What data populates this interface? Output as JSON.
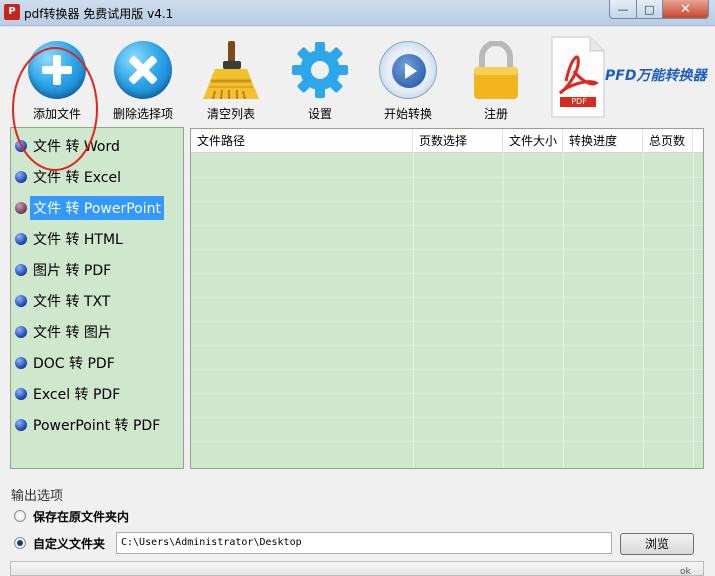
{
  "window": {
    "title": "pdf转换器 免费试用版 v4.1",
    "app_icon_char": "P",
    "buttons": {
      "minimize": "—",
      "maximize": "□",
      "close": "✕"
    }
  },
  "toolbar": {
    "add_file": "添加文件",
    "remove_selected": "删除选择项",
    "clear_list": "清空列表",
    "settings": "设置",
    "start_convert": "开始转换",
    "register": "注册"
  },
  "brand": {
    "name": "PFD万能转换器",
    "doc_badge": "PDF",
    "accent_color": "#1f5fbf"
  },
  "sidebar": {
    "items": [
      {
        "label": "文件 转 Word",
        "selected": false
      },
      {
        "label": "文件 转 Excel",
        "selected": false
      },
      {
        "label": "文件 转 PowerPoint",
        "selected": true
      },
      {
        "label": "文件 转 HTML",
        "selected": false
      },
      {
        "label": "图片 转 PDF",
        "selected": false
      },
      {
        "label": "文件 转 TXT",
        "selected": false
      },
      {
        "label": "文件 转 图片",
        "selected": false
      },
      {
        "label": "DOC 转 PDF",
        "selected": false
      },
      {
        "label": "Excel 转 PDF",
        "selected": false
      },
      {
        "label": "PowerPoint 转 PDF",
        "selected": false
      }
    ]
  },
  "file_table": {
    "columns": [
      "文件路径",
      "页数选择",
      "文件大小",
      "转换进度",
      "总页数"
    ],
    "rows": []
  },
  "output": {
    "title": "输出选项",
    "option_original": "保存在原文件夹内",
    "option_custom": "自定义文件夹",
    "selected_option": "custom",
    "path_value": "C:\\Users\\Administrator\\Desktop",
    "browse_label": "浏览"
  },
  "statusbar": {
    "ok_label": "ok"
  },
  "colors": {
    "list_background": "#cfe7cc",
    "selection": "#3399ff",
    "highlight_circle": "#e3231c"
  }
}
